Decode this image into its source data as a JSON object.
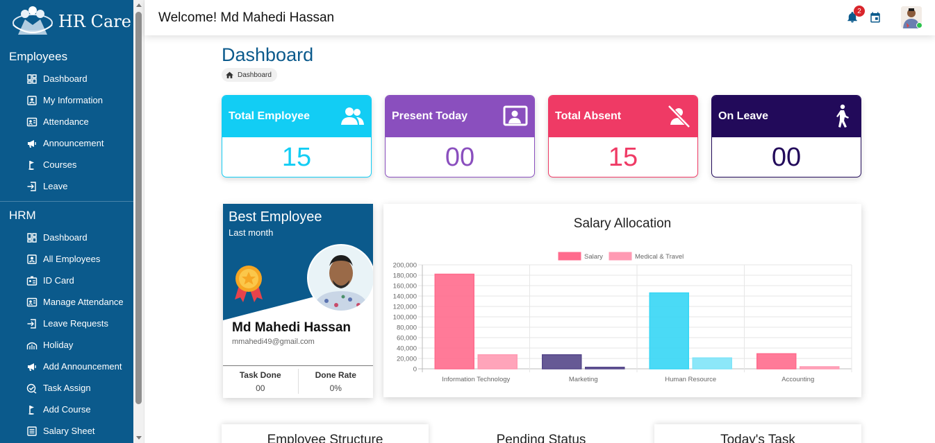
{
  "sidebar": {
    "brand": "HR Care",
    "employees_title": "Employees",
    "employees_items": [
      {
        "label": "Dashboard",
        "icon": "dashboard-icon"
      },
      {
        "label": "My Information",
        "icon": "user-card-icon"
      },
      {
        "label": "Attendance",
        "icon": "attendance-icon"
      },
      {
        "label": "Announcement",
        "icon": "megaphone-icon"
      },
      {
        "label": "Courses",
        "icon": "golf-flag-icon"
      },
      {
        "label": "Leave",
        "icon": "exit-icon"
      }
    ],
    "hrm_title": "HRM",
    "hrm_items": [
      {
        "label": "Dashboard",
        "icon": "dashboard-icon"
      },
      {
        "label": "All Employees",
        "icon": "user-card-icon"
      },
      {
        "label": "ID Card",
        "icon": "id-card-icon"
      },
      {
        "label": "Manage Attendance",
        "icon": "attendance-icon"
      },
      {
        "label": "Leave Requests",
        "icon": "exit-icon"
      },
      {
        "label": "Holiday",
        "icon": "bridge-icon"
      },
      {
        "label": "Add Announcement",
        "icon": "megaphone-icon"
      },
      {
        "label": "Task Assign",
        "icon": "task-check-icon"
      },
      {
        "label": "Add Course",
        "icon": "golf-flag-icon"
      },
      {
        "label": "Salary Sheet",
        "icon": "sheet-icon"
      }
    ]
  },
  "topbar": {
    "welcome": "Welcome! Md Mahedi Hassan",
    "notification_count": "2"
  },
  "page": {
    "title": "Dashboard",
    "breadcrumb": "Dashboard"
  },
  "stats": [
    {
      "label": "Total Employee",
      "value": "15",
      "color": "#12cdf4",
      "icon": "users-icon"
    },
    {
      "label": "Present Today",
      "value": "00",
      "color": "#8a4fbe",
      "icon": "presenter-icon"
    },
    {
      "label": "Total Absent",
      "value": "15",
      "color": "#ef3a65",
      "icon": "user-off-icon"
    },
    {
      "label": "On Leave",
      "value": "00",
      "color": "#220a5a",
      "icon": "walking-icon"
    }
  ],
  "best_employee": {
    "title": "Best Employee",
    "subtitle": "Last month",
    "name": "Md Mahedi Hassan",
    "email": "mmahedi49@gmail.com",
    "task_done_label": "Task Done",
    "task_done_value": "00",
    "done_rate_label": "Done Rate",
    "done_rate_value": "0%"
  },
  "bottom_cards": {
    "employee_structure": "Employee Structure",
    "pending_status": "Pending Status",
    "todays_task": "Today's Task"
  },
  "chart_data": {
    "type": "bar",
    "title": "Salary Allocation",
    "categories": [
      "Information Technology",
      "Marketing",
      "Human Resource",
      "Accounting"
    ],
    "series": [
      {
        "name": "Salary",
        "values": [
          182000,
          27000,
          146000,
          29000
        ]
      },
      {
        "name": "Medical & Travel",
        "values": [
          27000,
          3000,
          21000,
          4000
        ]
      }
    ],
    "bar_colors": [
      [
        "#ff6b8d",
        "#55478a",
        "#36d6f5",
        "#ff6b8d"
      ],
      [
        "#ff9ab3",
        "#55478a",
        "#7fe4f8",
        "#ff9ab3"
      ]
    ],
    "legend_colors": [
      "#ff6b8d",
      "#ff9ab3"
    ],
    "ylim": [
      0,
      200000
    ],
    "yticks": [
      "200,000",
      "180,000",
      "160,000",
      "140,000",
      "120,000",
      "100,000",
      "80,000",
      "60,000",
      "40,000",
      "20,000",
      "0"
    ],
    "legend_position": "top",
    "grid": true
  }
}
